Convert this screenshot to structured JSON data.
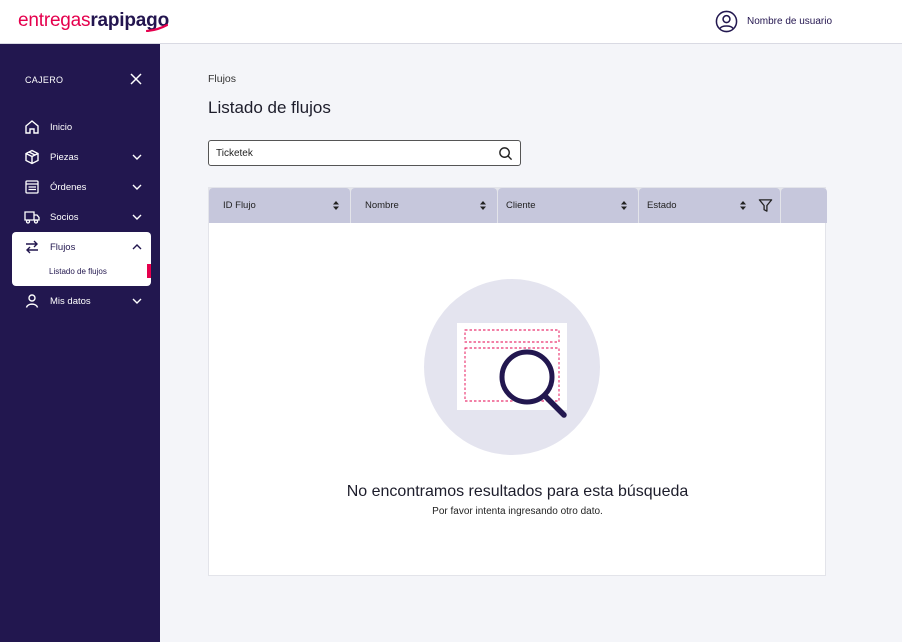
{
  "header": {
    "logo_part1": "entregas",
    "logo_part2": "rapipago",
    "user_name": "Nombre de usuario"
  },
  "sidebar": {
    "title": "CAJERO",
    "items": [
      {
        "label": "Inicio",
        "icon": "home-icon"
      },
      {
        "label": "Piezas",
        "icon": "box-icon"
      },
      {
        "label": "Órdenes",
        "icon": "list-icon"
      },
      {
        "label": "Socios",
        "icon": "truck-icon"
      },
      {
        "label": "Flujos",
        "icon": "swap-icon",
        "active": true,
        "subitems": [
          {
            "label": "Listado de flujos",
            "active": true
          }
        ]
      },
      {
        "label": "Mis datos",
        "icon": "user-icon"
      }
    ]
  },
  "main": {
    "breadcrumb": "Flujos",
    "title": "Listado de flujos",
    "search": {
      "value": "Ticketek"
    },
    "table": {
      "columns": [
        "ID Flujo",
        "Nombre",
        "Cliente",
        "Estado"
      ]
    },
    "empty": {
      "title": "No encontramos resultados para esta búsqueda",
      "subtitle": "Por favor intenta ingresando otro dato."
    }
  },
  "colors": {
    "brand_primary": "#22174f",
    "brand_accent": "#e5004d",
    "header_cell": "#c6c7dc"
  }
}
